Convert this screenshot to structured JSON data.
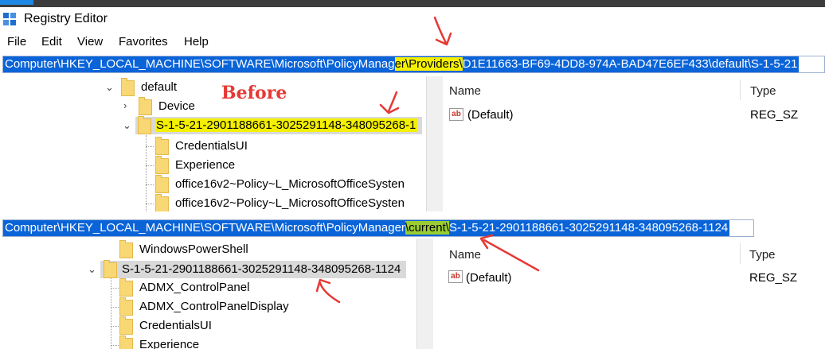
{
  "window": {
    "title": "Registry Editor"
  },
  "menu": [
    "File",
    "Edit",
    "View",
    "Favorites",
    "Help"
  ],
  "before": {
    "caption": "Before",
    "address": {
      "part1": "Computer\\HKEY_LOCAL_MACHINE\\SOFTWARE\\Microsoft\\PolicyManag",
      "highlight": "er\\Providers\\",
      "part2": "D1E11663-BF69-4DD8-974A-BAD47E6EF433\\default\\S-1-5-21"
    },
    "tree": [
      {
        "label": "default",
        "chevron": "expanded"
      },
      {
        "label": "Device",
        "chevron": "collapsed"
      },
      {
        "label": "S-1-5-21-2901188661-3025291148-348095268-1",
        "chevron": "expanded",
        "selected": true
      },
      {
        "label": "CredentialsUI"
      },
      {
        "label": "Experience"
      },
      {
        "label": "office16v2~Policy~L_MicrosoftOfficeSysten"
      },
      {
        "label": "office16v2~Policy~L_MicrosoftOfficeSysten"
      }
    ],
    "columns": {
      "name": "Name",
      "type": "Type"
    },
    "values": [
      {
        "name": "(Default)",
        "type": "REG_SZ",
        "icon": "ab"
      }
    ]
  },
  "after": {
    "address": {
      "part1": "Computer\\HKEY_LOCAL_MACHINE\\SOFTWARE\\Microsoft\\PolicyManager",
      "highlight": "\\current\\",
      "part2": "S-1-5-21-2901188661-3025291148-348095268-1124"
    },
    "tree": [
      {
        "label": "WindowsPowerShell"
      },
      {
        "label": "S-1-5-21-2901188661-3025291148-348095268-1124",
        "chevron": "expanded",
        "selected": true
      },
      {
        "label": "ADMX_ControlPanel"
      },
      {
        "label": "ADMX_ControlPanelDisplay"
      },
      {
        "label": "CredentialsUI"
      },
      {
        "label": "Experience"
      }
    ],
    "columns": {
      "name": "Name",
      "type": "Type"
    },
    "values": [
      {
        "name": "(Default)",
        "type": "REG_SZ",
        "icon": "ab"
      }
    ]
  },
  "colors": {
    "selection": "#0a64d8",
    "highlight_yellow": "#f4f000",
    "highlight_green": "#9acd32",
    "annotation": "#e53935"
  }
}
